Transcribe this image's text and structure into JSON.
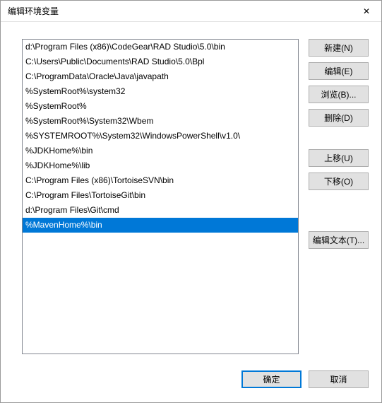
{
  "window": {
    "title": "编辑环境变量",
    "close_icon": "✕"
  },
  "paths": [
    "d:\\Program Files (x86)\\CodeGear\\RAD Studio\\5.0\\bin",
    "C:\\Users\\Public\\Documents\\RAD Studio\\5.0\\Bpl",
    "C:\\ProgramData\\Oracle\\Java\\javapath",
    "%SystemRoot%\\system32",
    "%SystemRoot%",
    "%SystemRoot%\\System32\\Wbem",
    "%SYSTEMROOT%\\System32\\WindowsPowerShell\\v1.0\\",
    "%JDKHome%\\bin",
    "%JDKHome%\\lib",
    "C:\\Program Files (x86)\\TortoiseSVN\\bin",
    "C:\\Program Files\\TortoiseGit\\bin",
    "d:\\Program Files\\Git\\cmd",
    "%MavenHome%\\bin"
  ],
  "selected_index": 12,
  "buttons": {
    "new": "新建(N)",
    "edit": "编辑(E)",
    "browse": "浏览(B)...",
    "delete": "删除(D)",
    "move_up": "上移(U)",
    "move_down": "下移(O)",
    "edit_text": "编辑文本(T)...",
    "ok": "确定",
    "cancel": "取消"
  }
}
